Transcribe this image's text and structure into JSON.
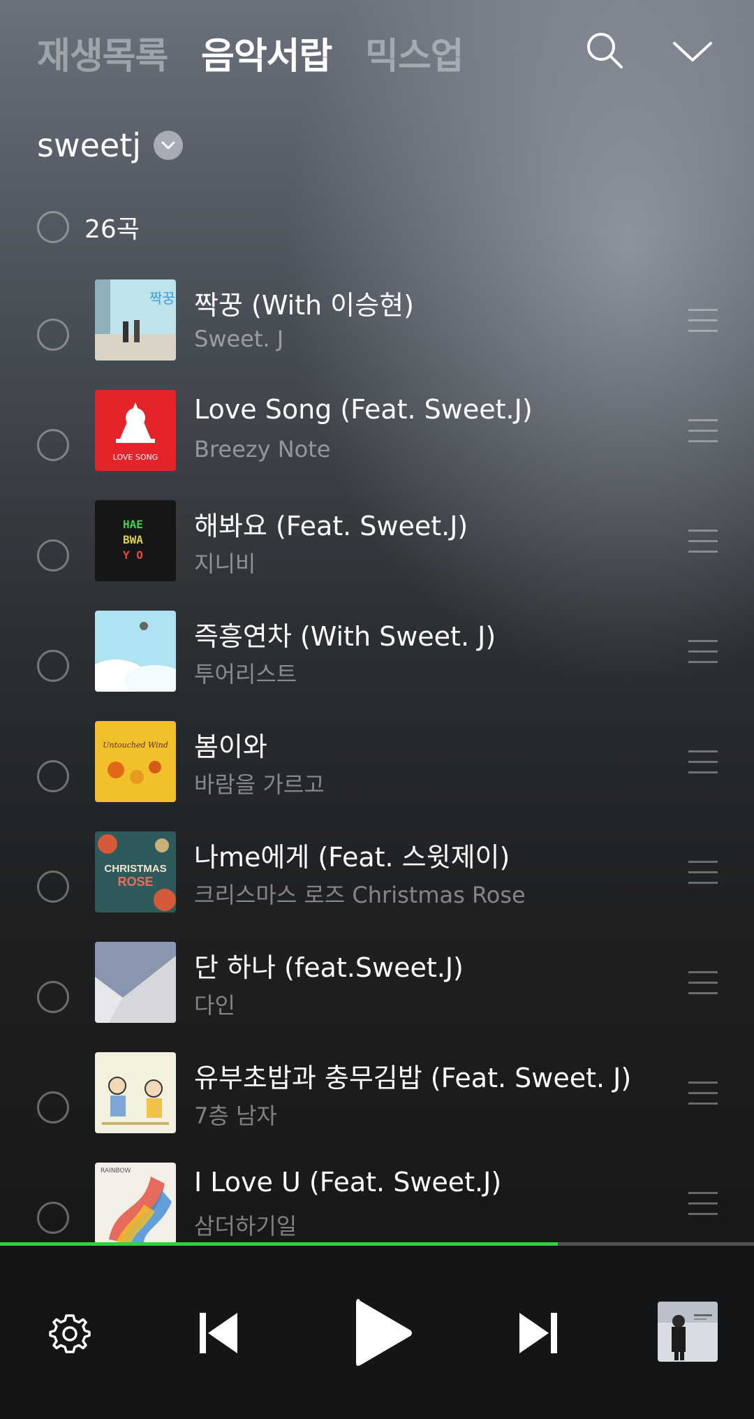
{
  "tabs": [
    {
      "label": "재생목록",
      "active": false
    },
    {
      "label": "음악서랍",
      "active": true
    },
    {
      "label": "믹스업",
      "active": false
    }
  ],
  "profile": {
    "name": "sweetj"
  },
  "count": {
    "label": "26곡"
  },
  "tracks": [
    {
      "title": "짝꿍 (With 이승현)",
      "artist": "Sweet. J",
      "art_icon": "album-art-jjakkung"
    },
    {
      "title": "Love Song (Feat. Sweet.J)",
      "artist": "Breezy Note",
      "art_icon": "album-art-love-song"
    },
    {
      "title": "해봐요 (Feat. Sweet.J)",
      "artist": "지니비",
      "art_icon": "album-art-haebwayo"
    },
    {
      "title": "즉흥연차 (With Sweet. J)",
      "artist": "투어리스트",
      "art_icon": "album-art-sky"
    },
    {
      "title": "봄이와",
      "artist": "바람을 가르고",
      "art_icon": "album-art-untouched-wind"
    },
    {
      "title": "나me에게 (Feat. 스윗제이)",
      "artist": "크리스마스 로즈 Christmas Rose",
      "art_icon": "album-art-christmas-rose"
    },
    {
      "title": "단 하나 (feat.Sweet.J)",
      "artist": "다인",
      "art_icon": "album-art-grey"
    },
    {
      "title": "유부초밥과 충무김밥 (Feat. Sweet. J)",
      "artist": "7층 남자",
      "art_icon": "album-art-cartoon"
    },
    {
      "title": "I Love U (Feat. Sweet.J)",
      "artist": "삼더하기일",
      "art_icon": "album-art-rainbow"
    }
  ],
  "album_art_text": {
    "jjakkung": "짝꿍",
    "love_song": "LOVE SONG",
    "haebwayo": [
      "HAE",
      "BWA",
      "Y O"
    ],
    "untouched": "Untouched Wind",
    "christmas": [
      "CHRISTMAS",
      "ROSE"
    ],
    "rainbow": "RAINBOW"
  },
  "progress": {
    "percent": 74
  },
  "player": {
    "icons": [
      "gear-icon",
      "skip-previous-icon",
      "play-icon",
      "skip-next-icon"
    ]
  },
  "colors": {
    "accent": "#2fd13f"
  }
}
